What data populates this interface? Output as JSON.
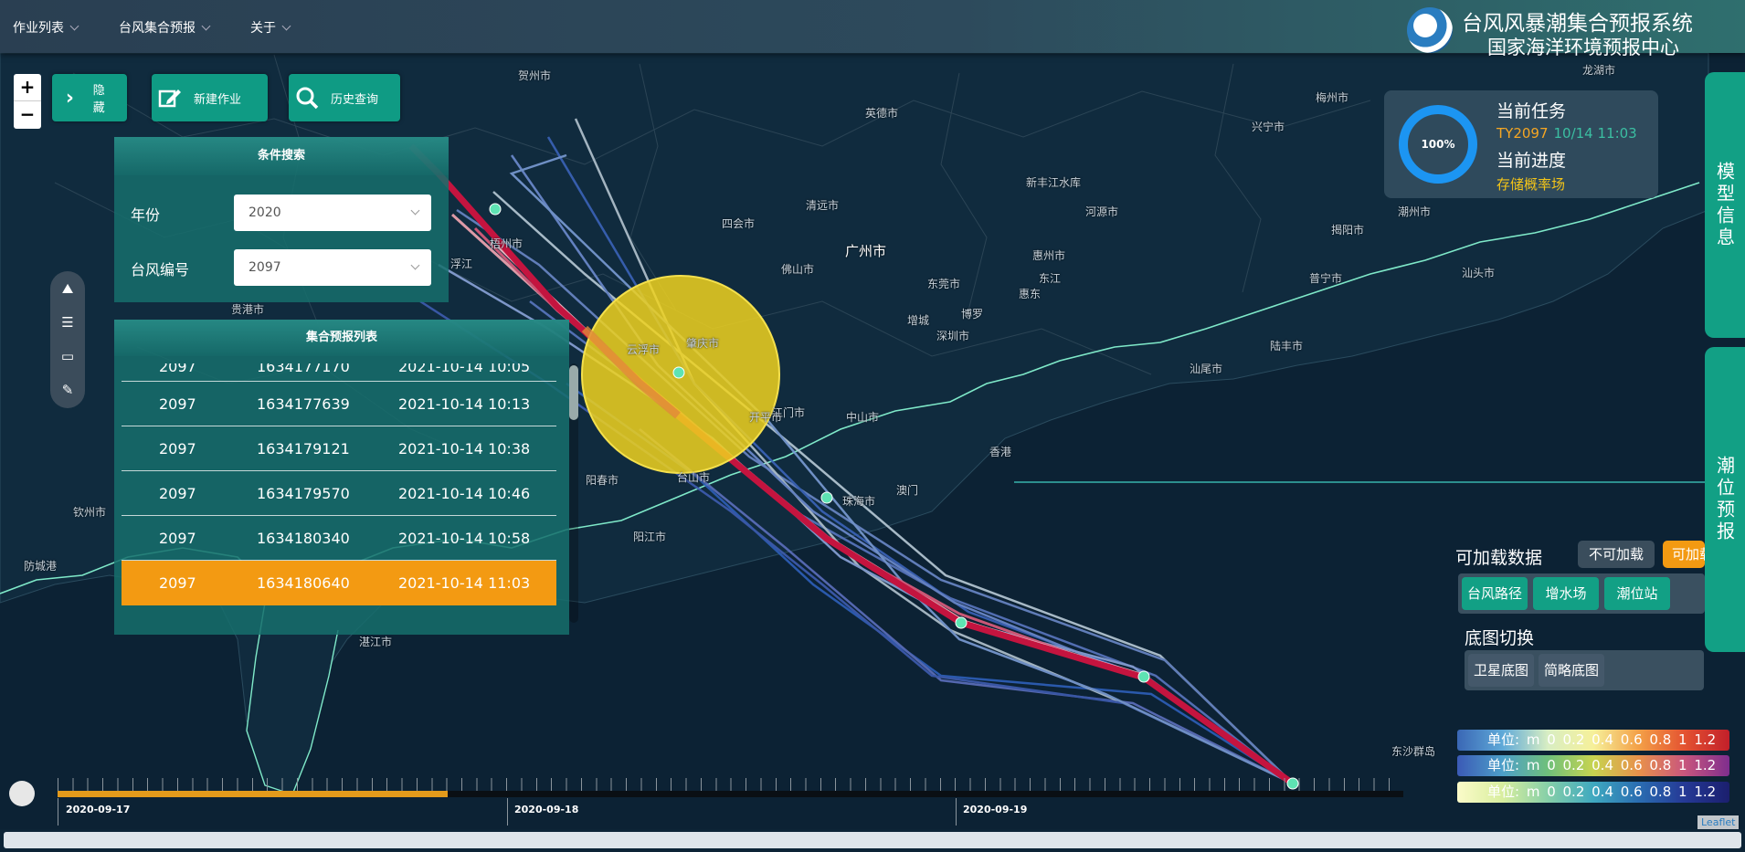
{
  "nav": {
    "items": [
      "作业列表",
      "台风集合预报",
      "关于"
    ]
  },
  "system": {
    "title": "台风风暴潮集合预报系统",
    "subtitle": "国家海洋环境预报中心"
  },
  "zoom": {
    "in_label": "+",
    "out_label": "−"
  },
  "toolbar": {
    "hide_label": "隐藏",
    "new_label": "新建作业",
    "history_label": "历史查询"
  },
  "search": {
    "title": "条件搜索",
    "year_label": "年份",
    "year_value": "2020",
    "typhoon_label": "台风编号",
    "typhoon_value": "2097"
  },
  "forecast_list": {
    "title": "集合预报列表",
    "partial_row": [
      "2097",
      "1634177170",
      "2021-10-14 10:05"
    ],
    "rows": [
      [
        "2097",
        "1634177639",
        "2021-10-14 10:13"
      ],
      [
        "2097",
        "1634179121",
        "2021-10-14 10:38"
      ],
      [
        "2097",
        "1634179570",
        "2021-10-14 10:46"
      ],
      [
        "2097",
        "1634180340",
        "2021-10-14 10:58"
      ],
      [
        "2097",
        "1634180640",
        "2021-10-14 11:03"
      ]
    ],
    "selected_index": 4
  },
  "task": {
    "progress_label": "100%",
    "progress": 1.0,
    "current_task_label": "当前任务",
    "task_id": "TY2097",
    "task_time": "10/14 11:03",
    "current_progress_label": "当前进度",
    "progress_status": "存储概率场"
  },
  "right_tabs": {
    "model_info": "模型信息",
    "tide_forecast": "潮位预报"
  },
  "loadable": {
    "title": "可加载数据",
    "not_loadable": "不可加载",
    "loadable": "可加载",
    "layers": [
      "台风路径",
      "增水场",
      "潮位站"
    ]
  },
  "basemap": {
    "title": "底图切换",
    "options": [
      "卫星底图",
      "简略底图"
    ]
  },
  "legends": [
    {
      "text": "单位: m  0  0.2  0.4  0.6  0.8  1  1.2",
      "gradient": "linear-gradient(90deg,#3a67b5,#5fa9d8,#d8eec3,#f6f09a,#f3a047,#e45331,#c21f2a)"
    },
    {
      "text": "单位: m  0  0.2  0.4  0.6  0.8  1  1.2",
      "gradient": "linear-gradient(90deg,#3b5ab6,#4d9fc9,#6fc07b,#c7d450,#e8914b,#c9567d,#7f2e8e)"
    },
    {
      "text": "单位: m  0  0.2  0.4  0.6  0.8  1  1.2",
      "gradient": "linear-gradient(90deg,#fbfbc9,#d8ee9f,#86cfa8,#3fa9c0,#2a6db1,#253996,#1b1f6e)"
    }
  ],
  "timeline": {
    "dates": [
      "2020-09-17",
      "2020-09-18",
      "2020-09-19"
    ],
    "progress": 0.29
  },
  "attribution": "Leaflet",
  "map_labels": [
    "贺州市",
    "梅州市",
    "英德市",
    "兴宁市",
    "新丰江水库",
    "河源市",
    "清远市",
    "潮州市",
    "揭阳市",
    "四会市",
    "广州市",
    "佛山市",
    "惠州市",
    "东莞市",
    "深圳市",
    "江门市",
    "中山市",
    "珠海市",
    "汕尾市",
    "陆丰市",
    "汕头市",
    "肇庆市",
    "云浮市",
    "阳春市",
    "阳江市",
    "钦州市",
    "防城港",
    "湛江市",
    "东沙群岛",
    "浮江",
    "梧州市",
    "贵港市",
    "台山市",
    "香港",
    "澳门",
    "普宁市",
    "东江",
    "龙湖市",
    "开平市",
    "增城",
    "博罗",
    "惠东"
  ],
  "colors": {
    "accent": "#12a085",
    "selected_row": "#f39a12",
    "progress_ring": "#1c95f2",
    "typhoon_circle": "#f0d21f"
  }
}
